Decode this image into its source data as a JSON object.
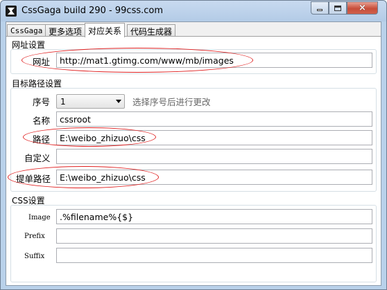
{
  "window": {
    "title": "CssGaga build 290 - 99css.com",
    "controls": {
      "minimize": "minimize",
      "maximize": "maximize",
      "close": "×"
    }
  },
  "tabs": [
    {
      "label": "CssGaga",
      "active": false
    },
    {
      "label": "更多选项",
      "active": false
    },
    {
      "label": "对应关系",
      "active": true
    },
    {
      "label": "代码生成器",
      "active": false
    }
  ],
  "url_settings": {
    "title": "网址设置",
    "url_label": "网址",
    "url_value": "http://mat1.gtimg.com/www/mb/images"
  },
  "target_path_settings": {
    "title": "目标路径设置",
    "index_label": "序号",
    "index_value": "1",
    "index_hint": "选择序号后进行更改",
    "name_label": "名称",
    "name_value": "cssroot",
    "path_label": "路径",
    "path_value": "E:\\weibo_zhizuo\\css",
    "custom_label": "自定义",
    "custom_value": "",
    "submit_path_label": "提单路径",
    "submit_path_value": "E:\\weibo_zhizuo\\css"
  },
  "css_settings": {
    "title": "CSS设置",
    "image_label": "Image",
    "image_value": ".%filename%{$}",
    "prefix_label": "Prefix",
    "prefix_value": "",
    "suffix_label": "Suffix",
    "suffix_value": ""
  },
  "annotations": {
    "oval_color": "#e02020"
  },
  "colors": {
    "title_bar": "#b9d1ea",
    "close_button": "#c74e3a",
    "panel_bg": "#ffffff"
  }
}
